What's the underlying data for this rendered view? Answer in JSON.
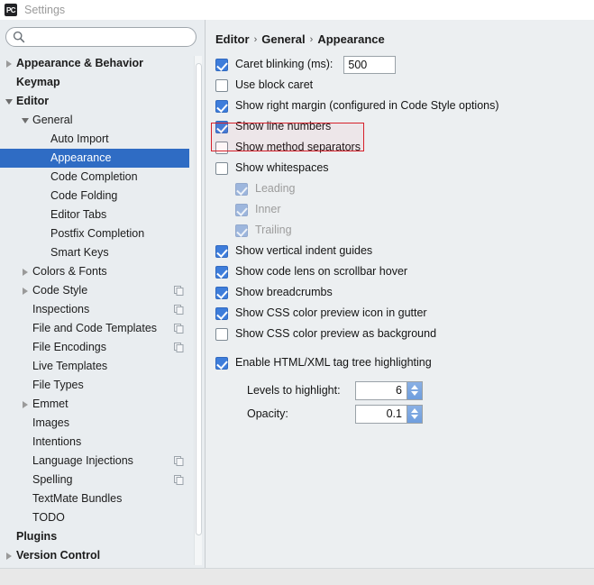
{
  "window": {
    "app_icon": "pycharm-icon",
    "app_icon_text": "PC",
    "title": "Settings"
  },
  "search": {
    "value": "",
    "placeholder": "",
    "icon": "search-icon"
  },
  "sidebar": {
    "items": [
      {
        "label": "Appearance & Behavior",
        "depth": 0,
        "arrow": "right",
        "bold": true,
        "selected": false,
        "config_icon": false
      },
      {
        "label": "Keymap",
        "depth": 0,
        "arrow": "none",
        "bold": true,
        "selected": false,
        "config_icon": false
      },
      {
        "label": "Editor",
        "depth": 0,
        "arrow": "down",
        "bold": true,
        "selected": false,
        "config_icon": false
      },
      {
        "label": "General",
        "depth": 1,
        "arrow": "down",
        "bold": false,
        "selected": false,
        "config_icon": false
      },
      {
        "label": "Auto Import",
        "depth": 2,
        "arrow": "none",
        "bold": false,
        "selected": false,
        "config_icon": false
      },
      {
        "label": "Appearance",
        "depth": 2,
        "arrow": "none",
        "bold": false,
        "selected": true,
        "config_icon": false
      },
      {
        "label": "Code Completion",
        "depth": 2,
        "arrow": "none",
        "bold": false,
        "selected": false,
        "config_icon": false
      },
      {
        "label": "Code Folding",
        "depth": 2,
        "arrow": "none",
        "bold": false,
        "selected": false,
        "config_icon": false
      },
      {
        "label": "Editor Tabs",
        "depth": 2,
        "arrow": "none",
        "bold": false,
        "selected": false,
        "config_icon": false
      },
      {
        "label": "Postfix Completion",
        "depth": 2,
        "arrow": "none",
        "bold": false,
        "selected": false,
        "config_icon": false
      },
      {
        "label": "Smart Keys",
        "depth": 2,
        "arrow": "none",
        "bold": false,
        "selected": false,
        "config_icon": false
      },
      {
        "label": "Colors & Fonts",
        "depth": 1,
        "arrow": "right",
        "bold": false,
        "selected": false,
        "config_icon": false
      },
      {
        "label": "Code Style",
        "depth": 1,
        "arrow": "right",
        "bold": false,
        "selected": false,
        "config_icon": true
      },
      {
        "label": "Inspections",
        "depth": 1,
        "arrow": "none",
        "bold": false,
        "selected": false,
        "config_icon": true
      },
      {
        "label": "File and Code Templates",
        "depth": 1,
        "arrow": "none",
        "bold": false,
        "selected": false,
        "config_icon": true
      },
      {
        "label": "File Encodings",
        "depth": 1,
        "arrow": "none",
        "bold": false,
        "selected": false,
        "config_icon": true
      },
      {
        "label": "Live Templates",
        "depth": 1,
        "arrow": "none",
        "bold": false,
        "selected": false,
        "config_icon": false
      },
      {
        "label": "File Types",
        "depth": 1,
        "arrow": "none",
        "bold": false,
        "selected": false,
        "config_icon": false
      },
      {
        "label": "Emmet",
        "depth": 1,
        "arrow": "right",
        "bold": false,
        "selected": false,
        "config_icon": false
      },
      {
        "label": "Images",
        "depth": 1,
        "arrow": "none",
        "bold": false,
        "selected": false,
        "config_icon": false
      },
      {
        "label": "Intentions",
        "depth": 1,
        "arrow": "none",
        "bold": false,
        "selected": false,
        "config_icon": false
      },
      {
        "label": "Language Injections",
        "depth": 1,
        "arrow": "none",
        "bold": false,
        "selected": false,
        "config_icon": true
      },
      {
        "label": "Spelling",
        "depth": 1,
        "arrow": "none",
        "bold": false,
        "selected": false,
        "config_icon": true
      },
      {
        "label": "TextMate Bundles",
        "depth": 1,
        "arrow": "none",
        "bold": false,
        "selected": false,
        "config_icon": false
      },
      {
        "label": "TODO",
        "depth": 1,
        "arrow": "none",
        "bold": false,
        "selected": false,
        "config_icon": false
      },
      {
        "label": "Plugins",
        "depth": 0,
        "arrow": "none",
        "bold": true,
        "selected": false,
        "config_icon": false
      },
      {
        "label": "Version Control",
        "depth": 0,
        "arrow": "right",
        "bold": true,
        "selected": false,
        "config_icon": false
      }
    ],
    "selection_color": "#2f6cc4"
  },
  "main": {
    "breadcrumb": [
      "Editor",
      "General",
      "Appearance"
    ],
    "breadcrumb_separator": "›",
    "options": [
      {
        "label": "Caret blinking (ms):",
        "state": "checked",
        "indent": false,
        "field": "500"
      },
      {
        "label": "Use block caret",
        "state": "unchecked",
        "indent": false
      },
      {
        "label": "Show right margin (configured in Code Style options)",
        "state": "checked",
        "indent": false
      },
      {
        "label": "Show line numbers",
        "state": "checked",
        "indent": false,
        "highlighted": true
      },
      {
        "label": "Show method separators",
        "state": "unchecked",
        "indent": false
      },
      {
        "label": "Show whitespaces",
        "state": "unchecked",
        "indent": false
      },
      {
        "label": "Leading",
        "state": "checked-disabled",
        "indent": true
      },
      {
        "label": "Inner",
        "state": "checked-disabled",
        "indent": true
      },
      {
        "label": "Trailing",
        "state": "checked-disabled",
        "indent": true
      },
      {
        "label": "Show vertical indent guides",
        "state": "checked",
        "indent": false
      },
      {
        "label": "Show code lens on scrollbar hover",
        "state": "checked",
        "indent": false
      },
      {
        "label": "Show breadcrumbs",
        "state": "checked",
        "indent": false
      },
      {
        "label": "Show CSS color preview icon in gutter",
        "state": "checked",
        "indent": false
      },
      {
        "label": "Show CSS color preview as background",
        "state": "unchecked",
        "indent": false
      }
    ],
    "html_section": {
      "label": "Enable HTML/XML tag tree highlighting",
      "state": "checked",
      "fields": [
        {
          "label": "Levels to highlight:",
          "value": "6"
        },
        {
          "label": "Opacity:",
          "value": "0.1"
        }
      ]
    },
    "annotation": {
      "name": "red-highlight-box",
      "color": "#d6202a",
      "target": "Show line numbers"
    }
  }
}
